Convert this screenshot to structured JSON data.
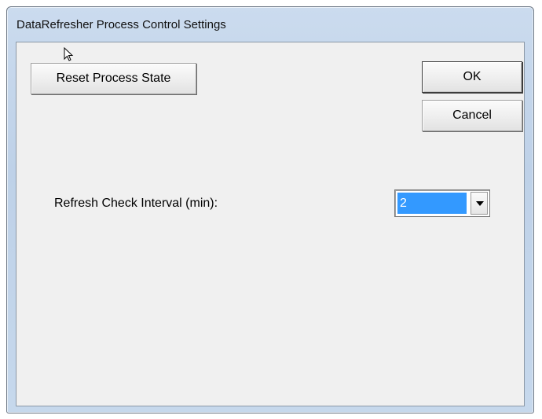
{
  "window": {
    "title": "DataRefresher Process Control Settings"
  },
  "buttons": {
    "reset_label": "Reset Process State",
    "ok_label": "OK",
    "cancel_label": "Cancel"
  },
  "refresh_interval": {
    "label": "Refresh Check Interval (min):",
    "selected_value": "2"
  },
  "icons": {
    "cursor": "mouse-pointer-icon",
    "dropdown": "chevron-down-icon"
  },
  "colors": {
    "selection_highlight": "#3399ff",
    "dialog_background": "#f0f0f0",
    "title_bar": "#c6d8ec"
  }
}
